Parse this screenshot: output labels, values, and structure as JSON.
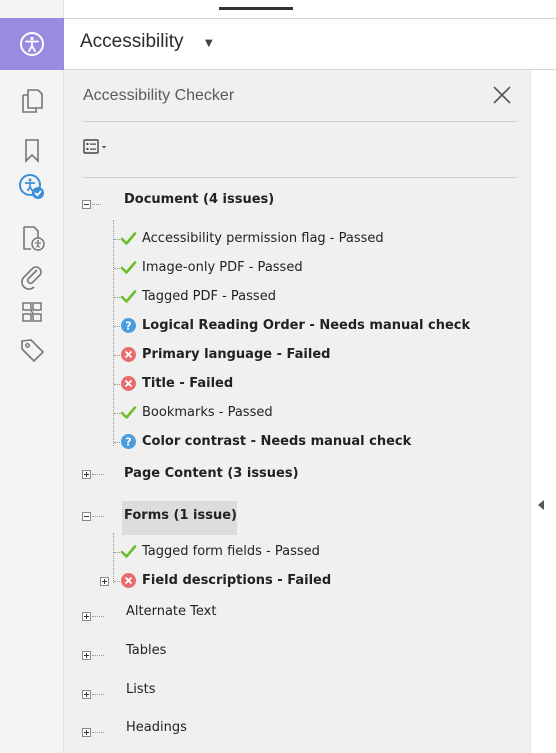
{
  "header": {
    "title": "Accessibility"
  },
  "panel": {
    "title": "Accessibility Checker"
  },
  "rail": {
    "icons": [
      "accessibility-icon",
      "pages-icon",
      "bookmark-icon",
      "accessibility-checker-icon",
      "file-accessibility-icon",
      "attachment-icon",
      "content-order-icon",
      "tags-icon"
    ]
  },
  "tree": {
    "document": {
      "label": "Document (4 issues)",
      "items": [
        {
          "label": "Accessibility permission flag - Passed",
          "status": "passed"
        },
        {
          "label": "Image-only PDF - Passed",
          "status": "passed"
        },
        {
          "label": "Tagged PDF - Passed",
          "status": "passed"
        },
        {
          "label": "Logical Reading Order - Needs manual check",
          "status": "manual"
        },
        {
          "label": "Primary language - Failed",
          "status": "failed"
        },
        {
          "label": "Title - Failed",
          "status": "failed"
        },
        {
          "label": "Bookmarks - Passed",
          "status": "passed"
        },
        {
          "label": "Color contrast - Needs manual check",
          "status": "manual"
        }
      ]
    },
    "page_content": {
      "label": "Page Content (3 issues)"
    },
    "forms": {
      "label": "Forms (1 issue)",
      "items": [
        {
          "label": "Tagged form fields - Passed",
          "status": "passed"
        },
        {
          "label": "Field descriptions - Failed",
          "status": "failed"
        }
      ]
    },
    "alternate_text": {
      "label": "Alternate Text"
    },
    "tables": {
      "label": "Tables"
    },
    "lists": {
      "label": "Lists"
    },
    "headings": {
      "label": "Headings"
    }
  },
  "colors": {
    "passed": "#6cbf2a",
    "failed": "#e86c6c",
    "manual": "#4a9ee0",
    "accent": "#9a8be0"
  }
}
